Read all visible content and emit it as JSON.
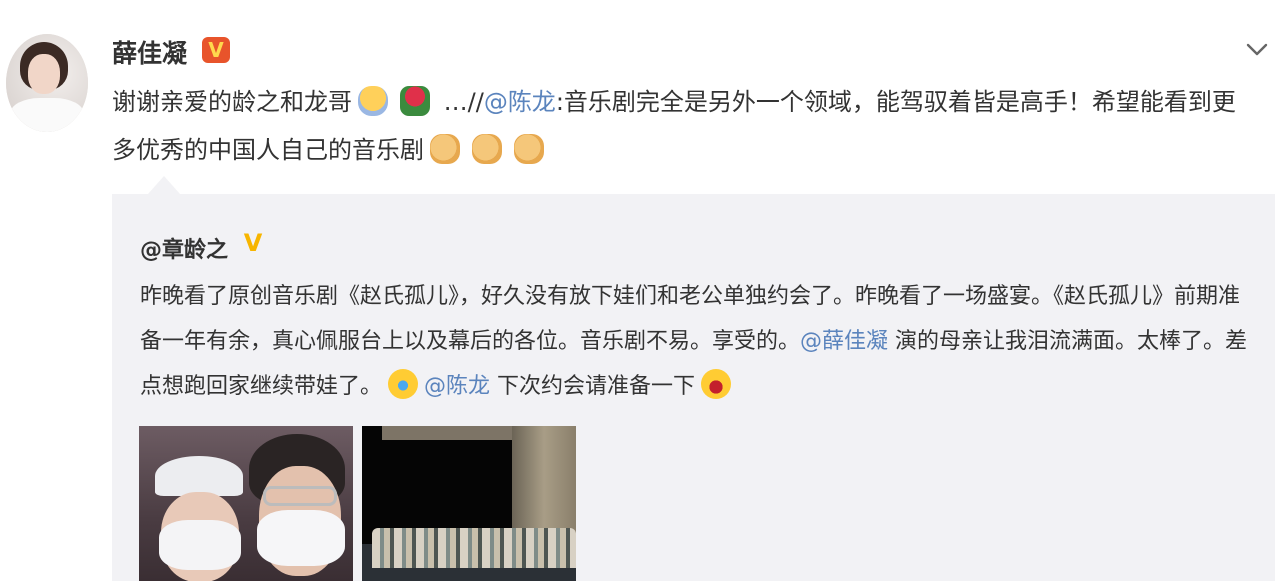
{
  "post": {
    "author": "薛佳凝",
    "verified_badge": "V",
    "text_part1": "谢谢亲爱的龄之和龙哥",
    "ellipsis_prefix": " …//",
    "mention": "@陈龙",
    "text_part2": ":音乐剧完全是另外一个领域，能驾驭着皆是高手！希望能看到更多优秀的中国人自己的音乐剧",
    "emojis": [
      "hug-emoji",
      "rose-emoji",
      "thumbs-up-emoji",
      "thumbs-up-emoji",
      "thumbs-up-emoji"
    ]
  },
  "repost": {
    "author": "@章龄之",
    "verified_badge": "V",
    "text_part1": "昨晚看了原创音乐剧《赵氏孤儿》，好久没有放下娃们和老公单独约会了。昨晚看了一场盛宴。《赵氏孤儿》前期准备一年有余，真心佩服台上以及幕后的各位。音乐剧不易。享受的。",
    "mention1": "@薛佳凝",
    "text_part2": " 演的母亲让我泪流满面。太棒了。差点想跑回家继续带娃了。",
    "mention2": "@陈龙",
    "text_part3": " 下次约会请准备一下",
    "photos": [
      "selfie-photo",
      "stage-photo"
    ]
  },
  "colors": {
    "mention_blue": "#5b84bd",
    "mention_orange": "#eb7350",
    "repost_bg": "#f2f2f5",
    "badge_orange": "#e8542b",
    "badge_gold": "#f7b500"
  },
  "icons": {
    "expand": "chevron-down-icon"
  }
}
